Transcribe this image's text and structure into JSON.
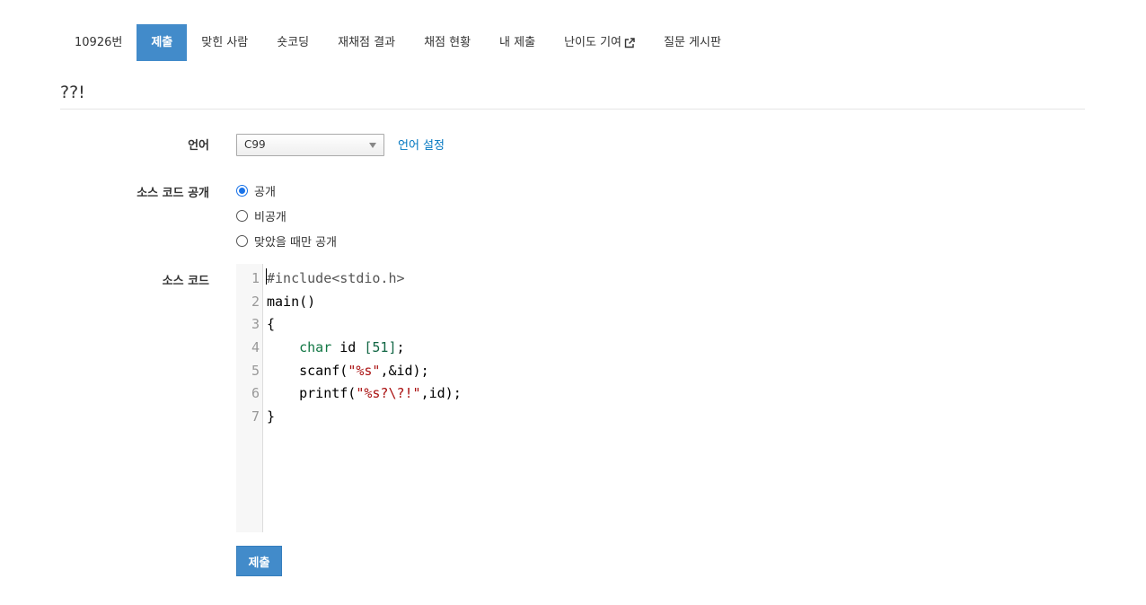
{
  "tabs": [
    {
      "label": "10926번",
      "active": false
    },
    {
      "label": "제출",
      "active": true
    },
    {
      "label": "맞힌 사람",
      "active": false
    },
    {
      "label": "숏코딩",
      "active": false
    },
    {
      "label": "재채점 결과",
      "active": false
    },
    {
      "label": "채점 현황",
      "active": false
    },
    {
      "label": "내 제출",
      "active": false
    },
    {
      "label": "난이도 기여",
      "active": false,
      "external": true
    },
    {
      "label": "질문 게시판",
      "active": false
    }
  ],
  "page": {
    "title": "??!"
  },
  "form": {
    "language_label": "언어",
    "language_value": "C99",
    "language_settings_link": "언어 설정",
    "visibility_label": "소스 코드 공개",
    "visibility_options": [
      {
        "label": "공개",
        "checked": true
      },
      {
        "label": "비공개",
        "checked": false
      },
      {
        "label": "맞았을 때만 공개",
        "checked": false
      }
    ],
    "source_label": "소스 코드",
    "submit_label": "제출"
  },
  "code": {
    "line_numbers": [
      "1",
      "2",
      "3",
      "4",
      "5",
      "6",
      "7"
    ],
    "lines": [
      "#include<stdio.h>",
      "main()",
      "{",
      "    char id [51];",
      "    scanf(\"%s\",&id);",
      "    printf(\"%s?\\?!\",id);",
      "}"
    ]
  },
  "colors": {
    "accent": "#428bca",
    "link": "#0076c0",
    "keyword": "#117744",
    "string": "#aa1111"
  },
  "icons": {
    "external_link": "external-link-icon"
  }
}
